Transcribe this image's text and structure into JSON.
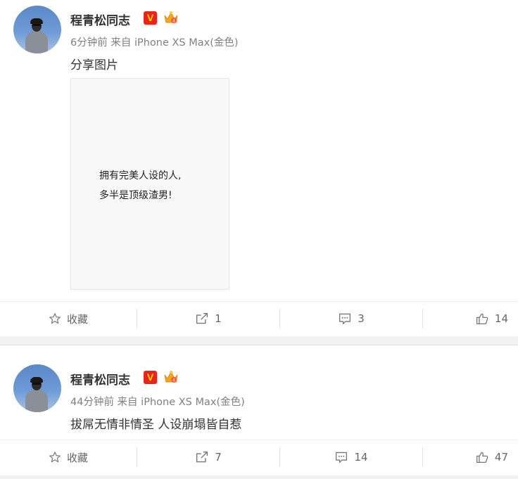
{
  "posts": [
    {
      "author": "程青松同志",
      "meta": "6分钟前 来自 iPhone XS Max(金色)",
      "text": "分享图片",
      "image_text": [
        "拥有完美人设的人,",
        "多半是顶级渣男!"
      ],
      "actions": {
        "favorite": "收藏",
        "repost": "1",
        "comment": "3",
        "like": "14"
      }
    },
    {
      "author": "程青松同志",
      "meta": "44分钟前 来自 iPhone XS Max(金色)",
      "text": "拔屌无情非情圣  人设崩塌皆自惹",
      "actions": {
        "favorite": "收藏",
        "repost": "7",
        "comment": "14",
        "like": "47"
      }
    }
  ],
  "badges": {
    "verified": "V",
    "verified_color": "#e8251d"
  },
  "icons": {
    "favorite": "star-icon",
    "repost": "share-icon",
    "comment": "comment-icon",
    "like": "thumbs-up-icon"
  }
}
